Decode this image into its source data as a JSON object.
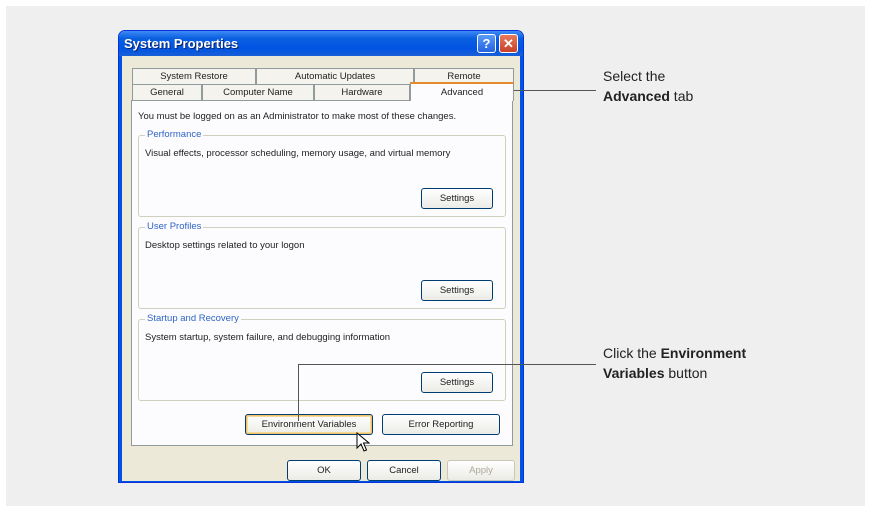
{
  "window": {
    "title": "System Properties",
    "help_glyph": "?",
    "close_glyph": "✕"
  },
  "tabs": {
    "row_back": [
      "System Restore",
      "Automatic Updates",
      "Remote"
    ],
    "row_front": [
      "General",
      "Computer Name",
      "Hardware",
      "Advanced"
    ],
    "active": "Advanced"
  },
  "sheet": {
    "note": "You must be logged on as an Administrator to make most of these changes.",
    "groups": [
      {
        "title": "Performance",
        "desc": "Visual effects, processor scheduling, memory usage, and virtual memory",
        "button": "Settings"
      },
      {
        "title": "User Profiles",
        "desc": "Desktop settings related to your logon",
        "button": "Settings"
      },
      {
        "title": "Startup and Recovery",
        "desc": "System startup, system failure, and debugging information",
        "button": "Settings"
      }
    ],
    "env_button": "Environment Variables",
    "error_button": "Error Reporting"
  },
  "footer": {
    "ok": "OK",
    "cancel": "Cancel",
    "apply": "Apply"
  },
  "callouts": {
    "one": {
      "prefix": "Select the",
      "bold": "Advanced",
      "suffix": " tab"
    },
    "two": {
      "prefix": "Click the ",
      "bold1": "Environment",
      "bold2": "Variables",
      "suffix": " button"
    }
  }
}
